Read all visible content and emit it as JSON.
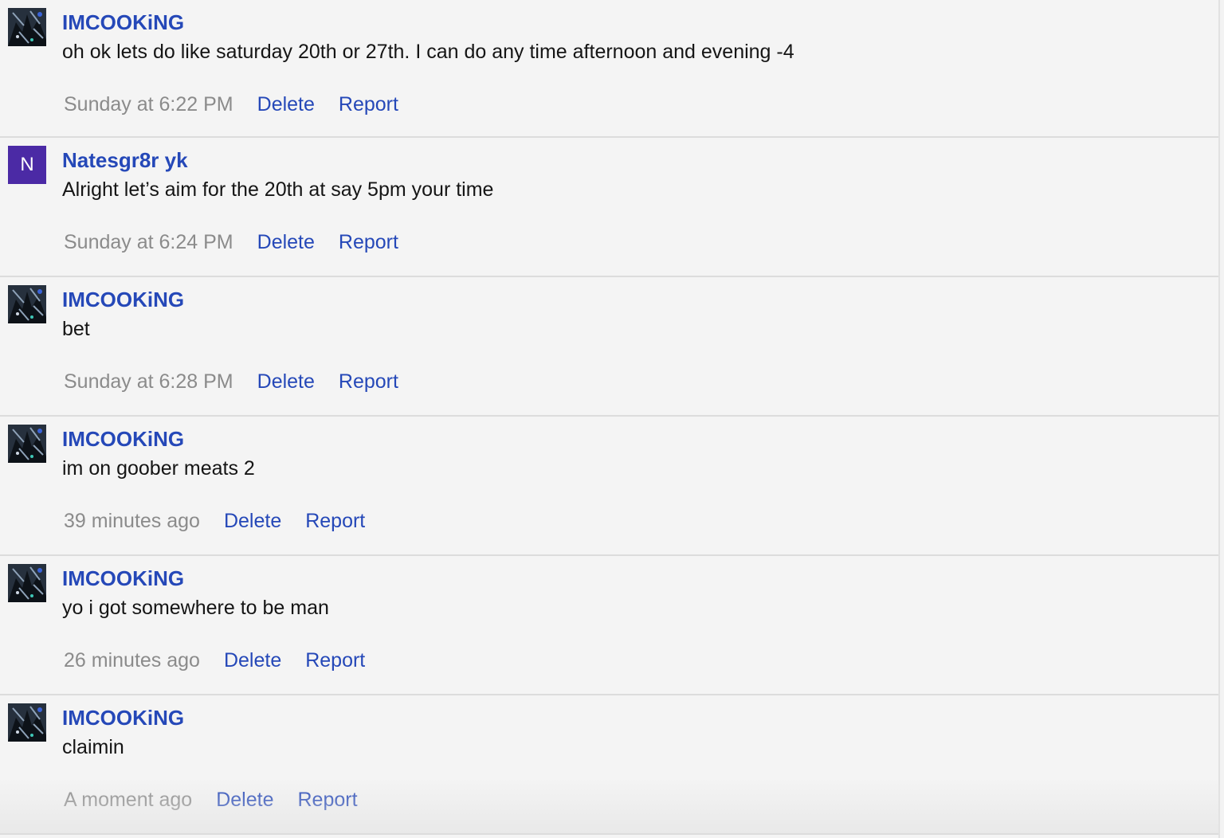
{
  "messages": [
    {
      "author": "IMCOOKiNG",
      "avatar": {
        "type": "image",
        "icon": "anime-character-avatar"
      },
      "text": "oh ok lets do like saturday 20th or 27th. I can do any time afternoon and evening -4",
      "time": "Sunday at 6:22 PM",
      "delete_label": "Delete",
      "report_label": "Report"
    },
    {
      "author": "Natesgr8r yk",
      "avatar": {
        "type": "letter",
        "letter": "N",
        "color": "#4b2aa5"
      },
      "text": "Alright let’s aim for the 20th at say 5pm your time",
      "time": "Sunday at 6:24 PM",
      "delete_label": "Delete",
      "report_label": "Report"
    },
    {
      "author": "IMCOOKiNG",
      "avatar": {
        "type": "image",
        "icon": "anime-character-avatar"
      },
      "text": "bet",
      "time": "Sunday at 6:28 PM",
      "delete_label": "Delete",
      "report_label": "Report"
    },
    {
      "author": "IMCOOKiNG",
      "avatar": {
        "type": "image",
        "icon": "anime-character-avatar"
      },
      "text": "im on goober meats 2",
      "time": "39 minutes ago",
      "delete_label": "Delete",
      "report_label": "Report"
    },
    {
      "author": "IMCOOKiNG",
      "avatar": {
        "type": "image",
        "icon": "anime-character-avatar"
      },
      "text": "yo i got somewhere to be man",
      "time": "26 minutes ago",
      "delete_label": "Delete",
      "report_label": "Report"
    },
    {
      "author": "IMCOOKiNG",
      "avatar": {
        "type": "image",
        "icon": "anime-character-avatar"
      },
      "text": "claimin",
      "time": "A moment ago",
      "delete_label": "Delete",
      "report_label": "Report"
    }
  ],
  "colors": {
    "link": "#2548b8",
    "timestamp": "#8b8b8b",
    "background": "#f4f4f4",
    "letter_avatar": "#4b2aa5"
  }
}
